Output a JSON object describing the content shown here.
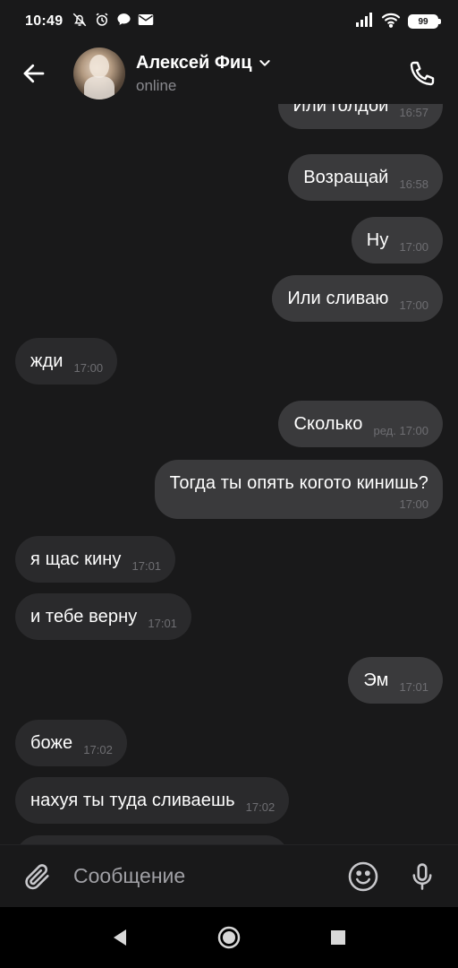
{
  "status_bar": {
    "time": "10:49",
    "battery": "99",
    "icons_left": [
      "muted-bell-icon",
      "alarm-icon",
      "chat-bubble-icon",
      "mail-icon"
    ],
    "icons_right": [
      "signal-icon",
      "wifi-icon",
      "battery-icon"
    ]
  },
  "header": {
    "contact_name": "Алексей Фиц",
    "contact_status": "online",
    "back_icon": "arrow-left-icon",
    "call_icon": "phone-icon"
  },
  "messages": [
    {
      "direction": "out",
      "text": "Или голдой",
      "time": "16:57"
    },
    {
      "direction": "out",
      "text": "Возращай",
      "time": "16:58"
    },
    {
      "direction": "out",
      "text": "Ну",
      "time": "17:00"
    },
    {
      "direction": "out",
      "text": "Или сливаю",
      "time": "17:00"
    },
    {
      "direction": "in",
      "text": "жди",
      "time": "17:00"
    },
    {
      "direction": "out",
      "text": "Сколько",
      "time": "ред. 17:00"
    },
    {
      "direction": "out",
      "text": "Тогда ты опять когото кинишь?",
      "time": "17:00"
    },
    {
      "direction": "in",
      "text": "я щас кину",
      "time": "17:01"
    },
    {
      "direction": "in",
      "text": "и тебе верну",
      "time": "17:01"
    },
    {
      "direction": "out",
      "text": "Эм",
      "time": "17:01"
    },
    {
      "direction": "in",
      "text": "боже",
      "time": "17:02"
    },
    {
      "direction": "in",
      "text": "нахуя ты туда сливаешь",
      "time": "17:02"
    }
  ],
  "composer": {
    "placeholder": "Сообщение",
    "attach_icon": "paperclip-icon",
    "emoji_icon": "smiley-icon",
    "mic_icon": "microphone-icon"
  },
  "navbar": {
    "icons": [
      "back-triangle-icon",
      "home-circle-icon",
      "recents-square-icon"
    ]
  },
  "colors": {
    "background": "#19191a",
    "outgoing_bubble": "#3a3a3c",
    "incoming_bubble": "#2a2a2c",
    "timestamp": "#6e6e72",
    "secondary_text": "#8a8a8f"
  }
}
